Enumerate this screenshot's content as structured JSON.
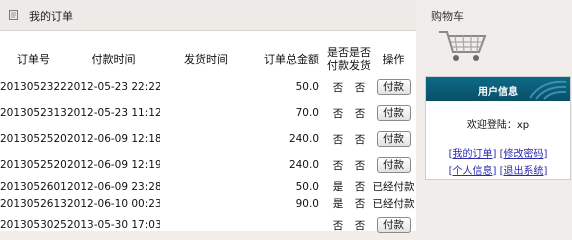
{
  "header": {
    "title": "我的订单",
    "icon": "document-icon"
  },
  "orders": {
    "columns": {
      "order_no": "订单号",
      "pay_time": "付款时间",
      "ship_time": "发货时间",
      "total": "订单总金额",
      "paid": "是否付款",
      "shipped": "是否发货",
      "action": "操作"
    },
    "pay_button_label": "付款",
    "rows": [
      {
        "order_no": "201305232253",
        "pay_time": "2012-05-23 22:22:22",
        "ship_time": "",
        "total": "50.0",
        "paid": "否",
        "shipped": "否",
        "action": "付款"
      },
      {
        "order_no": "201305231354",
        "pay_time": "2012-05-23 11:12:34",
        "ship_time": "",
        "total": "70.0",
        "paid": "否",
        "shipped": "否",
        "action": "付款"
      },
      {
        "order_no": "201305252095",
        "pay_time": "2012-06-09 12:18:11",
        "ship_time": "",
        "total": "240.0",
        "paid": "否",
        "shipped": "否",
        "action": "付款"
      },
      {
        "order_no": "20130525203",
        "pay_time": "2012-06-09 12:19:07",
        "ship_time": "",
        "total": "240.0",
        "paid": "否",
        "shipped": "否",
        "action": "付款"
      },
      {
        "order_no": "201305260130",
        "pay_time": "2012-06-09 23:28:07",
        "ship_time": "",
        "total": "50.0",
        "paid": "是",
        "shipped": "否",
        "action": "已经付款"
      },
      {
        "order_no": "201305261320",
        "pay_time": "2012-06-10 00:23:03",
        "ship_time": "",
        "total": "90.0",
        "paid": "是",
        "shipped": "否",
        "action": "已经付款"
      },
      {
        "order_no": "201305302557",
        "pay_time": "2013-05-30 17:03:01",
        "ship_time": "",
        "total": "",
        "paid": "否",
        "shipped": "否",
        "action": "付款"
      }
    ]
  },
  "cart": {
    "title": "购物车",
    "icon": "shopping-cart-icon"
  },
  "user_panel": {
    "title": "用户信息",
    "welcome_prefix": "欢迎登陆：",
    "username": "xp",
    "links": {
      "my_orders": "我的订单",
      "change_password": "修改密码",
      "personal_info": "个人信息",
      "logout": "退出系统"
    }
  },
  "colors": {
    "user_panel_header": "#0a5a76",
    "link": "#2a2ab0",
    "background": "#f1edea"
  }
}
